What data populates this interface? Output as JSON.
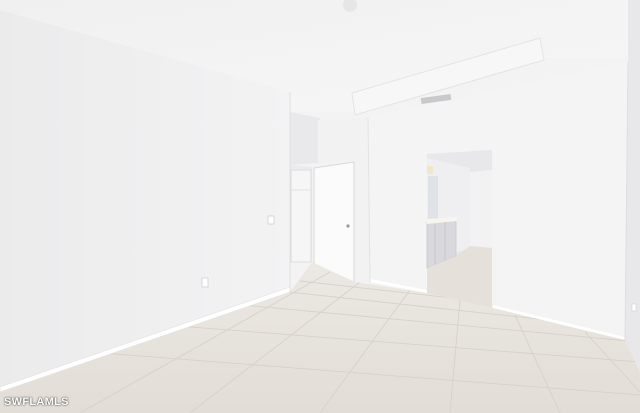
{
  "photo": {
    "watermark": "SWFLAMLS",
    "colors": {
      "ceiling": "#f5f5f5",
      "left_wall": "#f0f0f1",
      "back_wall": "#f4f4f5",
      "right_wall": "#efeff0",
      "floor": "#e7e2dc",
      "floor_grout": "#d6d0c8",
      "baseboard": "#ffffff",
      "door": "#fbfbfb",
      "doorway_shadow": "#e3e3e6",
      "vanity": "#dcdcdf",
      "countertop": "#f7f5ef"
    }
  }
}
